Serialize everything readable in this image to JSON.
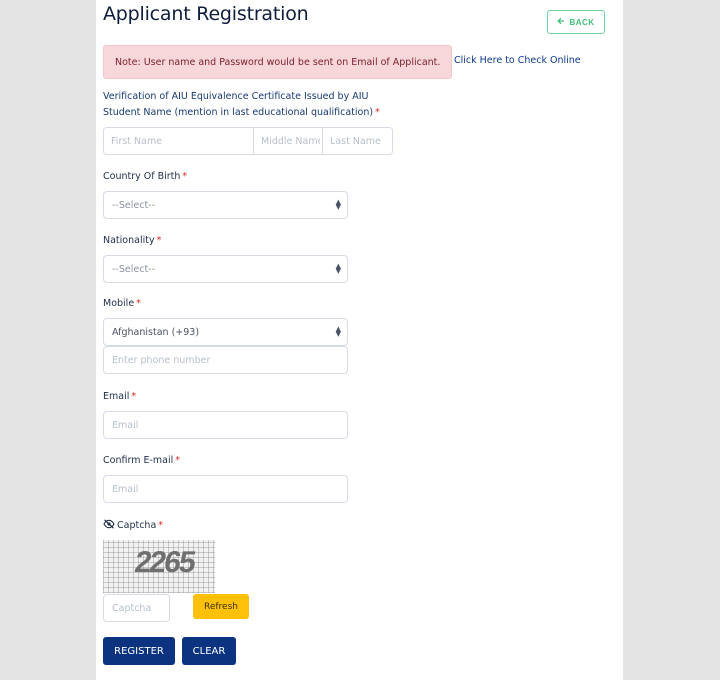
{
  "header": {
    "title": "Applicant Registration",
    "back_label": "BACK",
    "back_icon": "arrow-left-icon"
  },
  "note": {
    "text": "Note: User name and Password would be sent on Email of Applicant.",
    "link_text": "Click Here to Check Online"
  },
  "form": {
    "verification_heading": "Verification of AIU Equivalence Certificate Issued by AIU",
    "student_name": {
      "label": "Student Name (mention in last educational qualification)",
      "required": "*",
      "first_placeholder": "First Name",
      "middle_placeholder": "Middle Name",
      "last_placeholder": "Last Name"
    },
    "country_of_birth": {
      "label": "Country Of Birth",
      "required": "*",
      "selected": "--Select--"
    },
    "nationality": {
      "label": "Nationality",
      "required": "*",
      "selected": "--Select--"
    },
    "mobile": {
      "label": "Mobile",
      "required": "*",
      "country_code_selected": "Afghanistan (+93)",
      "phone_placeholder": "Enter phone number"
    },
    "email": {
      "label": "Email",
      "required": "*",
      "placeholder": "Email"
    },
    "confirm_email": {
      "label": "Confirm E-mail",
      "required": "*",
      "placeholder": "Email"
    },
    "captcha": {
      "label": "Captcha",
      "required": "*",
      "icon": "eye-slash-icon",
      "image_text": "2265",
      "placeholder": "Captcha",
      "refresh_label": "Refresh"
    },
    "register_label": "REGISTER",
    "clear_label": "CLEAR"
  },
  "colors": {
    "page_bg": "#e4e4e4",
    "title": "#0f1e3c",
    "back_accent": "#3fbf7a",
    "note_bg": "#f8d7da",
    "note_text": "#7a1f2b",
    "link": "#0b3a8c",
    "required": "#e02424",
    "primary_button": "#0b3380",
    "refresh_button": "#ffc107"
  }
}
